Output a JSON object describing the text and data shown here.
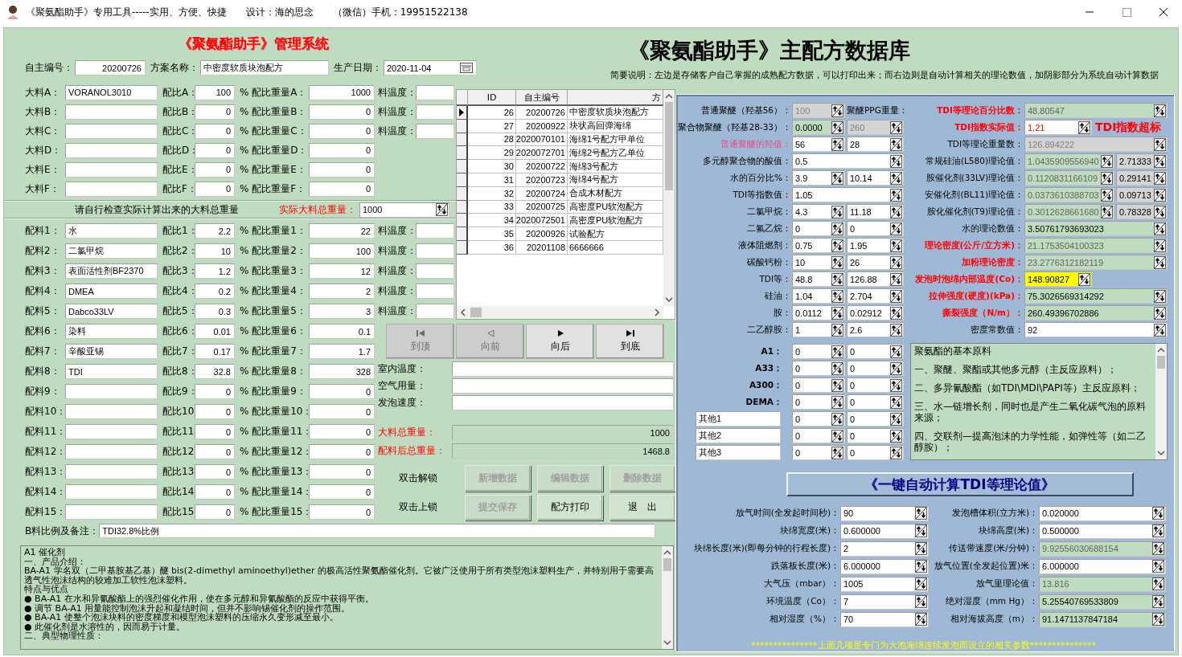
{
  "window": {
    "title": "《聚氨酯助手》专用工具-----实用、方便、快捷　　设计：海的思念　　（微信）手机：19951522138"
  },
  "app_title": "《聚氨酯助手》管理系统",
  "db_title": "《聚氨酯助手》主配方数据库",
  "intro": "简要说明：左边是存储客户自己掌握的成熟配方数据，可以打印出来；而右边则是自动计算相关的理论数值，加阴影部分为系统自动计算数据",
  "header_fields": [
    {
      "label": "自主编号：",
      "value": "20200726",
      "kind": "number"
    },
    {
      "label": "方案名称：",
      "value": "中密度软质块泡配方",
      "kind": "text"
    },
    {
      "label": "生产日期：",
      "value": "2020-11-04",
      "kind": "date"
    }
  ],
  "main_materials": [
    {
      "label": "大料A：",
      "name": "VORANOL3010",
      "ratio_label": "配比A：",
      "ratio": "100",
      "weight_label": "% 配比重量A：",
      "weight": "1000",
      "temp_label": "料温度："
    },
    {
      "label": "大料B：",
      "ratio_label": "配比B：",
      "ratio": "0",
      "weight_label": "% 配比重量B：",
      "weight": "0",
      "temp_label": "料温度："
    },
    {
      "label": "大料C：",
      "ratio_label": "配比C：",
      "ratio": "0",
      "weight_label": "% 配比重量C：",
      "weight": "0",
      "temp_label": "料温度："
    },
    {
      "label": "大料D：",
      "ratio_label": "配比D：",
      "ratio": "0",
      "weight_label": "% 配比重量D：",
      "weight": "0"
    },
    {
      "label": "大料E：",
      "ratio_label": "配比E：",
      "ratio": "0",
      "weight_label": "% 配比重量E：",
      "weight": "0"
    },
    {
      "label": "大料F：",
      "ratio_label": "配比F：",
      "ratio": "0",
      "weight_label": "% 配比重量F：",
      "weight": "0"
    }
  ],
  "total_check": {
    "note": "请自行检查实际计算出来的大料总重量",
    "label": "实际大料总重量：",
    "value": "1000"
  },
  "additives": [
    {
      "label": "配料1：",
      "name": "水",
      "ratio_label": "配比1：",
      "ratio": "2.2",
      "weight_label": "% 配比重量1：",
      "weight": "22",
      "temp_label": "料温度："
    },
    {
      "label": "配料2：",
      "name": "二氯甲烷",
      "ratio_label": "配比2：",
      "ratio": "10",
      "weight_label": "% 配比重量2：",
      "weight": "100",
      "temp_label": "料温度："
    },
    {
      "label": "配料3：",
      "name": "表面活性剂BF2370",
      "ratio_label": "配比3：",
      "ratio": "1.2",
      "weight_label": "% 配比重量3：",
      "weight": "12",
      "temp_label": "料温度："
    },
    {
      "label": "配料4：",
      "name": "DMEA",
      "ratio_label": "配比4：",
      "ratio": "0.2",
      "weight_label": "% 配比重量4：",
      "weight": "2",
      "temp_label": "料温度："
    },
    {
      "label": "配料5：",
      "name": "Dabco33LV",
      "ratio_label": "配比5：",
      "ratio": "0.3",
      "weight_label": "% 配比重量5：",
      "weight": "3",
      "temp_label": "料温度："
    },
    {
      "label": "配料6：",
      "name": "染料",
      "ratio_label": "配比6：",
      "ratio": "0.01",
      "weight_label": "% 配比重量6：",
      "weight": "0.1"
    },
    {
      "label": "配料7：",
      "name": "辛酸亚锡",
      "ratio_label": "配比7：",
      "ratio": "0.17",
      "weight_label": "% 配比重量7：",
      "weight": "1.7"
    },
    {
      "label": "配料8：",
      "name": "TDI",
      "ratio_label": "配比8：",
      "ratio": "32.8",
      "weight_label": "% 配比重量8：",
      "weight": "328"
    },
    {
      "label": "配料9：",
      "ratio_label": "配比9：",
      "ratio": "0",
      "weight_label": "% 配比重量9：",
      "weight": "0"
    },
    {
      "label": "配料10：",
      "ratio_label": "配比10",
      "ratio": "0",
      "weight_label": "% 配比重量10：",
      "weight": "0"
    },
    {
      "label": "配料11：",
      "ratio_label": "配比11",
      "ratio": "0",
      "weight_label": "% 配比重量11：",
      "weight": "0"
    },
    {
      "label": "配料12：",
      "ratio_label": "配比12",
      "ratio": "0",
      "weight_label": "% 配比重量12：",
      "weight": "0"
    },
    {
      "label": "配料13：",
      "ratio_label": "配比13",
      "ratio": "0",
      "weight_label": "% 配比重量13：",
      "weight": "0"
    },
    {
      "label": "配料14：",
      "ratio_label": "配比14",
      "ratio": "0",
      "weight_label": "% 配比重量14：",
      "weight": "0"
    },
    {
      "label": "配料15：",
      "ratio_label": "配比15",
      "ratio": "0",
      "weight_label": "% 配比重量15：",
      "weight": "0"
    }
  ],
  "table": {
    "columns": [
      "ID",
      "自主编号",
      "方"
    ],
    "rows": [
      {
        "cells": [
          "26",
          "20200726",
          "中密度软质块泡配方"
        ],
        "selected": true
      },
      {
        "cells": [
          "27",
          "20200922",
          "块状高回弹海绵"
        ],
        "selected": false
      },
      {
        "cells": [
          "28",
          "2020070101",
          "海绵1号配方甲单位"
        ],
        "selected": false
      },
      {
        "cells": [
          "29",
          "2020072701",
          "海绵2号配方乙单位"
        ],
        "selected": false
      },
      {
        "cells": [
          "30",
          "20200722",
          "海绵3号配方"
        ],
        "selected": false
      },
      {
        "cells": [
          "31",
          "20200723",
          "海绵4号配方"
        ],
        "selected": false
      },
      {
        "cells": [
          "32",
          "20200724",
          "合成木材配方"
        ],
        "selected": false
      },
      {
        "cells": [
          "33",
          "20200725",
          "高密度PU软泡配方"
        ],
        "selected": false
      },
      {
        "cells": [
          "34",
          "2020072501",
          "高密度PU软泡配方"
        ],
        "selected": false
      },
      {
        "cells": [
          "35",
          "20200926",
          "试验配方"
        ],
        "selected": false
      },
      {
        "cells": [
          "36",
          "20201108",
          "6666666"
        ],
        "selected": false
      }
    ]
  },
  "nav_buttons": [
    {
      "label": "到顶",
      "disabled": true
    },
    {
      "label": "向前",
      "disabled": true
    },
    {
      "label": "向后",
      "disabled": false
    },
    {
      "label": "到底",
      "disabled": false
    }
  ],
  "env_fields": [
    {
      "label": "室内温度："
    },
    {
      "label": "空气用量："
    },
    {
      "label": "发泡速度："
    }
  ],
  "totals": [
    {
      "label": "大料总重量：",
      "value": "1000"
    },
    {
      "label": "配料后总重量：",
      "value": "1468.8"
    }
  ],
  "lock_hints": [
    "双击解锁",
    "双击上锁"
  ],
  "actions": [
    {
      "label": "新增数据",
      "disabled": true
    },
    {
      "label": "编辑数据",
      "disabled": true
    },
    {
      "label": "删除数据",
      "disabled": true
    },
    {
      "label": "提交保存",
      "disabled": true
    },
    {
      "label": "配方打印",
      "disabled": false
    },
    {
      "label": "退　出",
      "disabled": false
    }
  ],
  "remark": {
    "label": "B料比例及备注：",
    "value": "TDI32.8%比例"
  },
  "catalyst_notes": [
    "A1 催化剂",
    "一、产品介绍：",
    "BA-A1 学名双（二甲基胺基乙基）醚 bis(2-dimethyl aminoethyl)ether 的极高活性聚氨酯催化剂。它被广泛使用于所有类型泡沫塑料生产，并特别用于需要高透气性泡沫结构的较难加工软性泡沫塑料。",
    "特点与优点",
    "● BA-A1 在水和异氰酸酯上的强烈催化作用，使在多元醇和异氰酸酯的反应中获得平衡。",
    "● 调节 BA-A1 用量能控制泡沫升起和凝结时间，但并不影响锡催化剂的操作范围。",
    "● BA-A1 使整个泡沫块料的密度梯度和模型泡沫塑料的压缩永久变形减至最小。",
    "● 此催化剂是水溶性的，因而易于计量。",
    "二、典型物理性质："
  ],
  "calc_panel": {
    "left_rows": [
      {
        "label": "普通聚醚（羟基56）：",
        "kind": "field_label",
        "fields": [
          {
            "value": "100",
            "kind": "locked"
          }
        ],
        "text": "聚醚PPG重量："
      },
      {
        "label": "聚合物聚醚（羟基28-33）：",
        "kind": "pair",
        "fields": [
          {
            "value": "0.0000",
            "kind": "result"
          },
          {
            "value": "260",
            "kind": "locked"
          }
        ]
      },
      {
        "label": "普通聚醚的羟值：",
        "color": "#e05090",
        "kind": "pair",
        "fields": [
          {
            "value": "56",
            "kind": "input"
          },
          {
            "value": "28",
            "kind": "input"
          }
        ]
      },
      {
        "label": "多元醇聚合物的酸值：",
        "kind": "wide",
        "fields": [
          {
            "value": "0.5",
            "kind": "input"
          }
        ]
      },
      {
        "label": "水的百分比%：",
        "kind": "pair",
        "fields": [
          {
            "value": "3.9",
            "kind": "input"
          },
          {
            "value": "10.14",
            "kind": "input"
          }
        ]
      },
      {
        "label": "TDI等指数值：",
        "kind": "wide",
        "fields": [
          {
            "value": "1.05",
            "kind": "input"
          }
        ]
      },
      {
        "label": "二氯甲烷：",
        "kind": "pair",
        "fields": [
          {
            "value": "4.3",
            "kind": "input"
          },
          {
            "value": "11.18",
            "kind": "input"
          }
        ]
      },
      {
        "label": "二氟乙烷：",
        "kind": "pair",
        "fields": [
          {
            "value": "0",
            "kind": "input"
          },
          {
            "value": "0",
            "kind": "input"
          }
        ]
      },
      {
        "label": "液体阻燃剂：",
        "kind": "pair",
        "fields": [
          {
            "value": "0.75",
            "kind": "input"
          },
          {
            "value": "1.95",
            "kind": "input"
          }
        ]
      },
      {
        "label": "碳酸钙粉：",
        "kind": "pair",
        "fields": [
          {
            "value": "10",
            "kind": "input"
          },
          {
            "value": "26",
            "kind": "input"
          }
        ]
      },
      {
        "label": "TDI等：",
        "kind": "pair",
        "fields": [
          {
            "value": "48.8",
            "kind": "input"
          },
          {
            "value": "126.88",
            "kind": "input"
          }
        ]
      },
      {
        "label": "硅油：",
        "kind": "pair",
        "fields": [
          {
            "value": "1.04",
            "kind": "input"
          },
          {
            "value": "2.704",
            "kind": "input"
          }
        ]
      },
      {
        "label": "胺：",
        "kind": "pair",
        "fields": [
          {
            "value": "0.0112",
            "kind": "input"
          },
          {
            "value": "0.02912",
            "kind": "input"
          }
        ]
      },
      {
        "label": "二乙醇胺：",
        "kind": "pair",
        "fields": [
          {
            "value": "1",
            "kind": "input"
          },
          {
            "value": "2.6",
            "kind": "input"
          }
        ]
      }
    ],
    "right_rows": [
      {
        "label": "TDI等理论百分比数：",
        "color": "#ff0000",
        "kind": "wide",
        "fields": [
          {
            "value": "48.80547",
            "kind": "computed"
          }
        ]
      },
      {
        "label": "TDI指数实际值：",
        "color": "#ff0000",
        "kind": "narrow",
        "fields": [
          {
            "value": "1.21",
            "kind": "alert"
          }
        ],
        "warning": "TDI指数超标"
      },
      {
        "label": "TDI等理论重量数：",
        "kind": "wide",
        "fields": [
          {
            "value": "126.894222",
            "kind": "locked"
          }
        ]
      },
      {
        "label": "常规硅油(L580)理论值：",
        "kind": "pair",
        "fields": [
          {
            "value": "1.0435909556940",
            "kind": "computed"
          },
          {
            "value": "2.71333",
            "kind": "grey"
          }
        ]
      },
      {
        "label": "胺催化剂(33LV)理论值：",
        "kind": "pair",
        "fields": [
          {
            "value": "0.1120831166109",
            "kind": "computed"
          },
          {
            "value": "0.29141",
            "kind": "grey"
          }
        ]
      },
      {
        "label": "安催化剂(BL11)理论值：",
        "kind": "pair",
        "fields": [
          {
            "value": "0.0373610388703",
            "kind": "computed"
          },
          {
            "value": "0.09713",
            "kind": "grey"
          }
        ]
      },
      {
        "label": "胺化催化剂(T9)理论值：",
        "kind": "pair",
        "fields": [
          {
            "value": "0.3012628661680",
            "kind": "computed"
          },
          {
            "value": "0.78328",
            "kind": "grey"
          }
        ]
      },
      {
        "label": "水的理论数值：",
        "kind": "wide",
        "fields": [
          {
            "value": "3.50761793693023",
            "kind": "result"
          }
        ]
      },
      {
        "label": "理论密度(公斤/立方米)：",
        "color": "#ff0000",
        "kind": "wide",
        "fields": [
          {
            "value": "21.1753504100323",
            "kind": "computed"
          }
        ]
      },
      {
        "label": "加粉理论密度：",
        "color": "#ff0000",
        "kind": "wide",
        "fields": [
          {
            "value": "23.2776312182119",
            "kind": "computed"
          }
        ]
      },
      {
        "label": "发泡时泡绵内部温度(Co)：",
        "color": "#ff0000",
        "kind": "narrow",
        "fields": [
          {
            "value": "148.90827",
            "kind": "highlight"
          }
        ]
      },
      {
        "label": "拉伸强度(硬度)(kPa)：",
        "color": "#ff0000",
        "kind": "wide",
        "fields": [
          {
            "value": "75.3026569314292",
            "kind": "result"
          }
        ]
      },
      {
        "label": "撕裂强度（N/m）：",
        "color": "#ff0000",
        "kind": "wide",
        "fields": [
          {
            "value": "260.49396702886",
            "kind": "result"
          }
        ]
      },
      {
        "label": "密度常数值：",
        "kind": "wide",
        "fields": [
          {
            "value": "92",
            "kind": "input"
          }
        ]
      }
    ],
    "extra_rows": [
      {
        "kind": "label",
        "label": "A1：",
        "values": [
          "0",
          "0"
        ]
      },
      {
        "kind": "label",
        "label": "A33：",
        "values": [
          "0",
          "0"
        ]
      },
      {
        "kind": "label",
        "label": "A300：",
        "values": [
          "0",
          "0"
        ]
      },
      {
        "kind": "label",
        "label": "DEMA：",
        "values": [
          "0",
          "0"
        ]
      },
      {
        "kind": "named",
        "label": "其他1",
        "values": [
          "0",
          "0"
        ]
      },
      {
        "kind": "named",
        "label": "其他2",
        "values": [
          "0",
          "0"
        ]
      },
      {
        "kind": "named",
        "label": "其他3",
        "values": [
          "0",
          "0"
        ]
      }
    ],
    "materials_note": [
      "聚氨酯的基本原料",
      "一、聚醚、聚酯或其他多元醇（主反应原料）；",
      "二、多异氰酸酯（如TDI\\MDI\\PAPI等）主反应原料；",
      "三、水—链增长剂，同时也是产生二氧化碳气泡的原料来源；",
      "四、交联剂—提高泡沫的力学性能，如弹性等（如二乙醇胺）；"
    ],
    "calc_button": "《一键自动计算TDI等理论值》",
    "foam_left": [
      {
        "label": "放气时间(全发起时间秒)：",
        "value": "90"
      },
      {
        "label": "块绵宽度(米)：",
        "value": "0.600000"
      },
      {
        "label": "块绵长度(米)(即每分钟的行程长度)：",
        "value": "2"
      },
      {
        "label": "跌落板长度(米)：",
        "value": "6.000000"
      },
      {
        "label": "大气压（mbar）：",
        "value": "1005"
      },
      {
        "label": "环境温度（Co）：",
        "value": "7"
      },
      {
        "label": "相对湿度（%）：",
        "value": "70"
      }
    ],
    "foam_right": [
      {
        "label": "发泡槽体积(立方米)：",
        "value": "0.020000",
        "kind": "input"
      },
      {
        "label": "块绵高度(米)：",
        "value": "0.500000",
        "kind": "input"
      },
      {
        "label": "传送带速度(米/分钟)：",
        "value": "9.92556030688154",
        "kind": "computed"
      },
      {
        "label": "放气位置(全发起位置)米：",
        "value": "6.000000",
        "kind": "input"
      },
      {
        "label": "放气里理论值：",
        "value": "13.816",
        "kind": "computed"
      },
      {
        "label": "绝对湿度（mm Hg）：",
        "value": "5.25540769533809",
        "kind": "result"
      },
      {
        "label": "相对海拔高度（m）：",
        "value": "91.1471137847184",
        "kind": "result"
      }
    ],
    "footer": "***************上面几项是专门为大泡海绵连续发泡而设立的相关参数***************"
  }
}
